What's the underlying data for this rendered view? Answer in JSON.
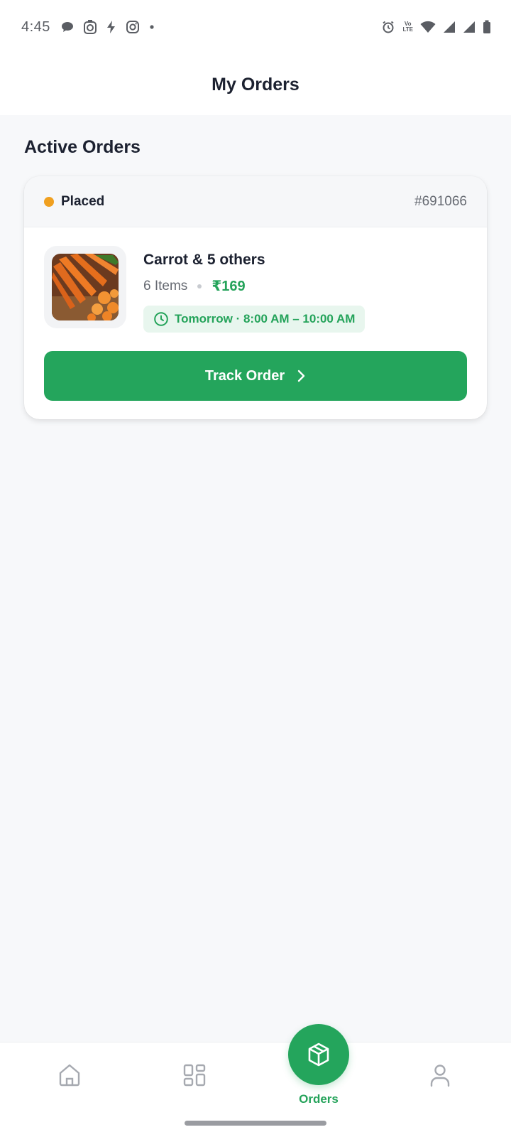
{
  "status_bar": {
    "time": "4:45",
    "left_icons": [
      "chat-bubble-icon",
      "timer-app-icon",
      "bolt-app-icon",
      "instagram-icon",
      "dot-icon"
    ],
    "right_icons": [
      "alarm-icon",
      "volte-icon",
      "wifi-icon",
      "signal-icon",
      "signal-icon",
      "battery-icon"
    ],
    "volte_top": "Vo",
    "volte_bottom": "LTE"
  },
  "header": {
    "title": "My Orders"
  },
  "active_orders": {
    "section_title": "Active Orders",
    "orders": [
      {
        "status": "Placed",
        "status_color": "#f0a020",
        "order_id": "#691066",
        "thumbnail_icon": "carrot-image",
        "title": "Carrot & 5 others",
        "item_count": "6 Items",
        "price": "₹169",
        "delivery_slot": "Tomorrow · 8:00 AM – 10:00 AM",
        "action_label": "Track Order"
      }
    ]
  },
  "bottom_nav": {
    "items": [
      {
        "icon": "home-icon",
        "label": "",
        "active": false
      },
      {
        "icon": "categories-icon",
        "label": "",
        "active": false
      },
      {
        "icon": "box-icon",
        "label": "Orders",
        "active": true
      },
      {
        "icon": "profile-icon",
        "label": "",
        "active": false
      }
    ]
  },
  "colors": {
    "accent": "#24a55c",
    "accent_text": "#24a35a",
    "chip_bg": "#e8f6ee",
    "status_placed": "#f0a020",
    "page_bg": "#f7f8fa"
  }
}
